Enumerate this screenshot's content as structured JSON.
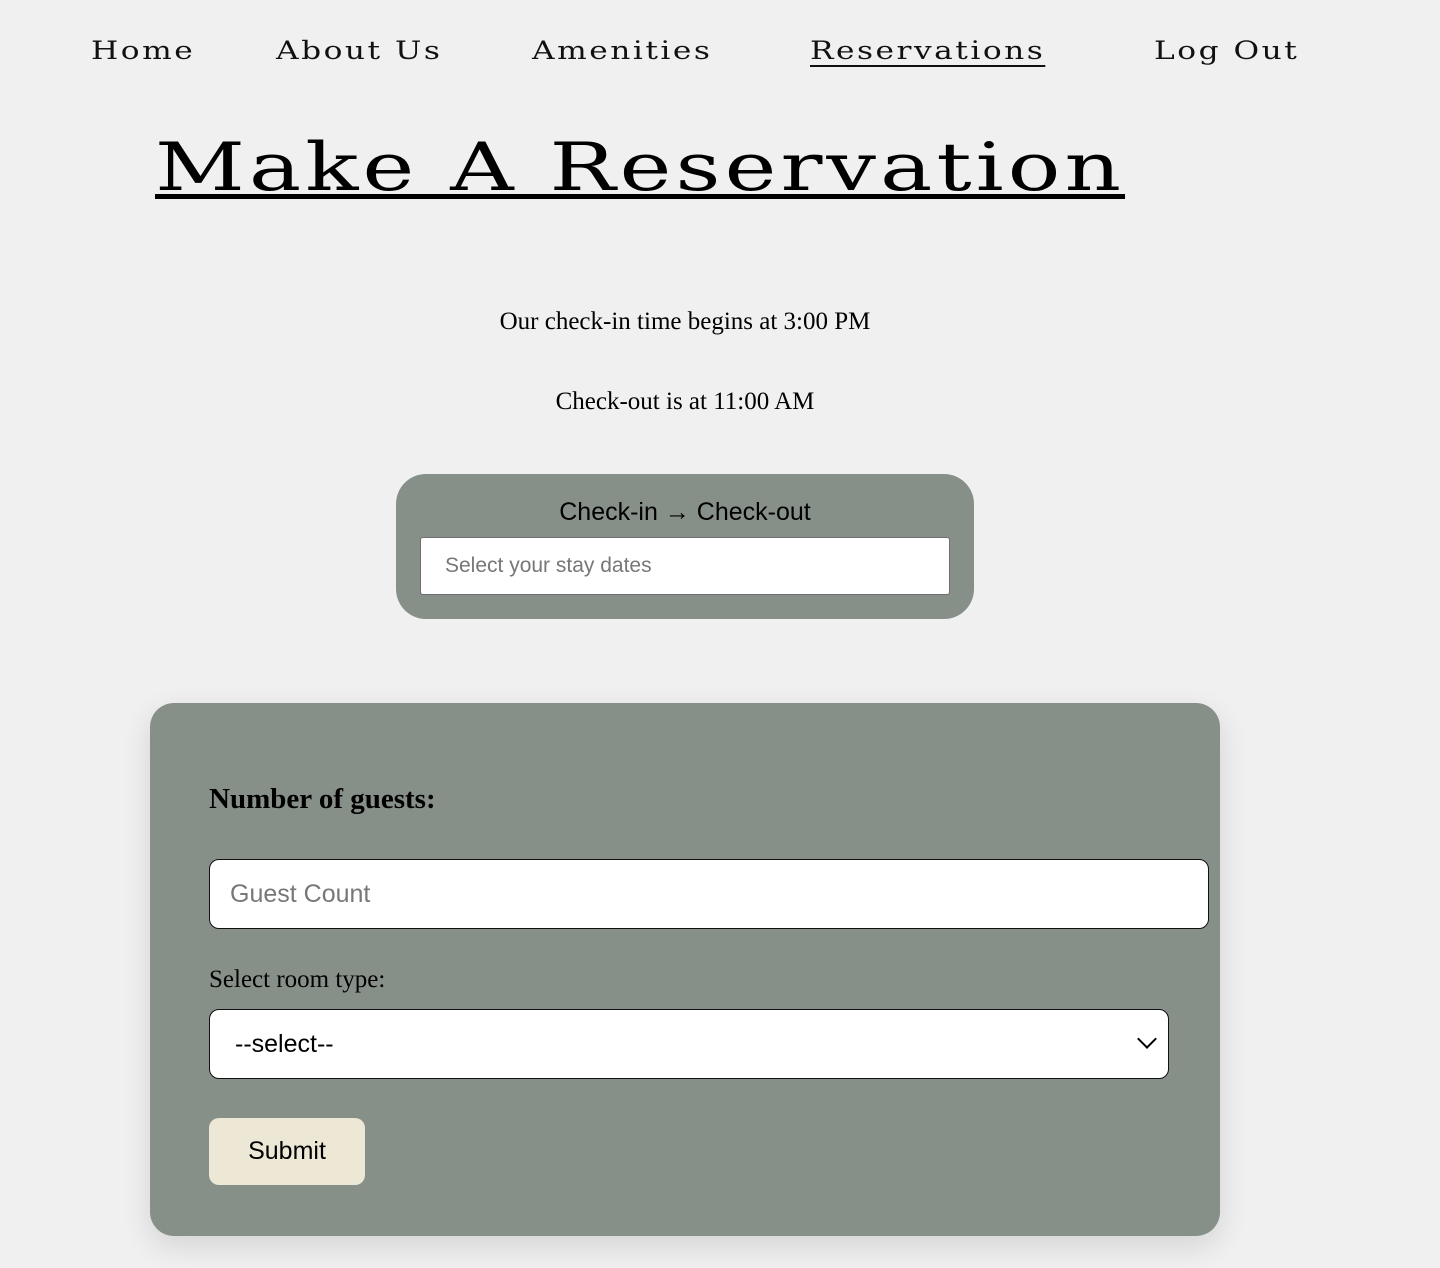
{
  "nav": {
    "items": [
      {
        "label": "Home"
      },
      {
        "label": "About Us"
      },
      {
        "label": "Amenities"
      },
      {
        "label": "Reservations"
      },
      {
        "label": "Log Out"
      }
    ]
  },
  "page": {
    "title": "Make A Reservation",
    "checkin_info": "Our check-in time begins at 3:00 PM",
    "checkout_info": "Check-out is at 11:00 AM"
  },
  "dates": {
    "label": "Check-in → Check-out",
    "placeholder": "Select your stay dates"
  },
  "form": {
    "guests_label": "Number of guests:",
    "guests_placeholder": "Guest Count",
    "room_label": "Select room type:",
    "room_selected": "--select--",
    "submit_label": "Submit"
  }
}
